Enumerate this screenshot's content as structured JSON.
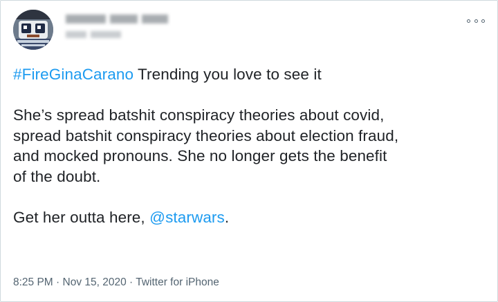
{
  "tweet": {
    "hashtag": "#FireGinaCarano",
    "line1_rest": " Trending you love to see it",
    "para2": [
      "She’s spread batshit conspiracy theories about covid,",
      "spread batshit conspiracy theories about election fraud,",
      "and mocked pronouns. She no longer gets the benefit",
      "of the doubt."
    ],
    "line_last_prefix": "Get her outta here, ",
    "mention": "@starwars",
    "line_last_suffix": "."
  },
  "meta": {
    "time": "8:25 PM",
    "separator": " · ",
    "date": "Nov 15, 2020",
    "source": "Twitter for iPhone"
  },
  "colors": {
    "link": "#1d9bf0",
    "text": "#202327",
    "meta": "#536471",
    "border": "#cfd9de"
  },
  "icons": {
    "more": "more-options-icon",
    "avatar": "profile-avatar"
  }
}
